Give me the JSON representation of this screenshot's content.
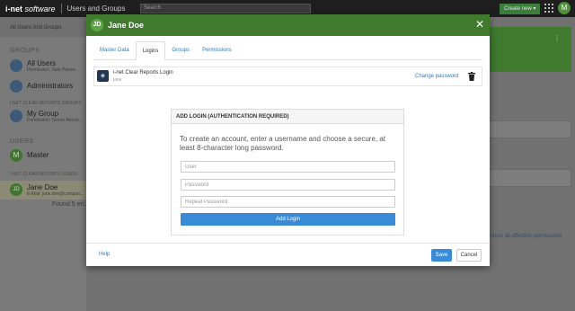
{
  "topbar": {
    "brand": "i-net",
    "brand_italic": "software",
    "app_title": "Users and Groups",
    "search_placeholder": "Search",
    "create_label": "Create new ▾",
    "avatar_letter": "M"
  },
  "sidebar": {
    "header": "All Users And Groups",
    "groups_section": "GROUPS",
    "all_users": {
      "title": "All Users",
      "sub": "Permission: Task Passw..."
    },
    "administrators": {
      "title": "Administrators"
    },
    "clear_reports_groups": "I-NET CLEAR REPORTS GROUPS",
    "my_group": {
      "title": "My Group",
      "sub": "Permission: Server Admin..."
    },
    "users_section": "USERS",
    "master": {
      "letter": "M",
      "title": "Master"
    },
    "clear_reports_users": "I-NET CLEAR REPORTS USERS",
    "jane": {
      "letter": "JD",
      "title": "Jane Doe",
      "sub": "E-Mail: jane.doe@compan..."
    },
    "found": "Found 5 en..."
  },
  "background": {
    "effective_permissions_link": "Show all effective permissions",
    "kebab": "⋮"
  },
  "modal": {
    "avatar": "JD",
    "title": "Jane Doe",
    "close": "✕",
    "tabs": [
      {
        "label": "Master Data"
      },
      {
        "label": "Logins"
      },
      {
        "label": "Groups"
      },
      {
        "label": "Permissions"
      }
    ],
    "login": {
      "name": "i-net Clear Reports Login",
      "user": "jane",
      "change_password": "Change password"
    },
    "add_login": {
      "heading": "ADD LOGIN (AUTHENTICATION REQUIRED)",
      "description": "To create an account, enter a username and choose a secure, at least 8-character long password.",
      "user_placeholder": "User",
      "password_placeholder": "Password",
      "repeat_placeholder": "Repeat Password",
      "button": "Add Login"
    },
    "footer": {
      "help": "Help",
      "save": "Save",
      "cancel": "Cancel"
    }
  },
  "colors": {
    "header_green": "#3f7a2f",
    "link_blue": "#2f7bbf",
    "primary_button": "#3a8bd6"
  },
  "icons": [
    "close-icon",
    "trash-icon",
    "login-type-icon",
    "apps-grid-icon",
    "kebab-menu-icon",
    "group-icon"
  ]
}
